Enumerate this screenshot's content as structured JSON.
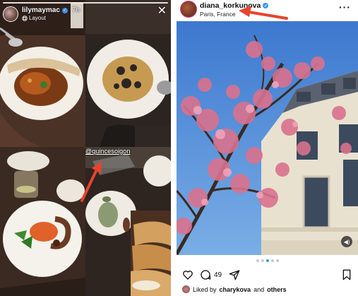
{
  "story": {
    "username": "lilymaymac",
    "time": "7h",
    "layout_label": "Layout",
    "location_tag": "@quincesoigon"
  },
  "post": {
    "username": "diana_korkunova",
    "location": "Paris, France",
    "comment_count": "49",
    "liked_by_prefix": "Liked by",
    "liked_by_user": "charykova",
    "liked_by_and": "and",
    "liked_by_others": "others"
  },
  "icons": {
    "close": "close-icon",
    "layout": "layout-icon",
    "verified": "verified-icon",
    "more": "more-icon",
    "heart": "heart-icon",
    "comment": "comment-icon",
    "share": "share-icon",
    "bookmark": "bookmark-icon",
    "audio": "audio-icon"
  },
  "colors": {
    "annotation_arrow": "#e8432f",
    "verified_blue": "#3897f0",
    "sky_blue": "#5a8fd6",
    "blossom_pink": "#d9728e"
  }
}
